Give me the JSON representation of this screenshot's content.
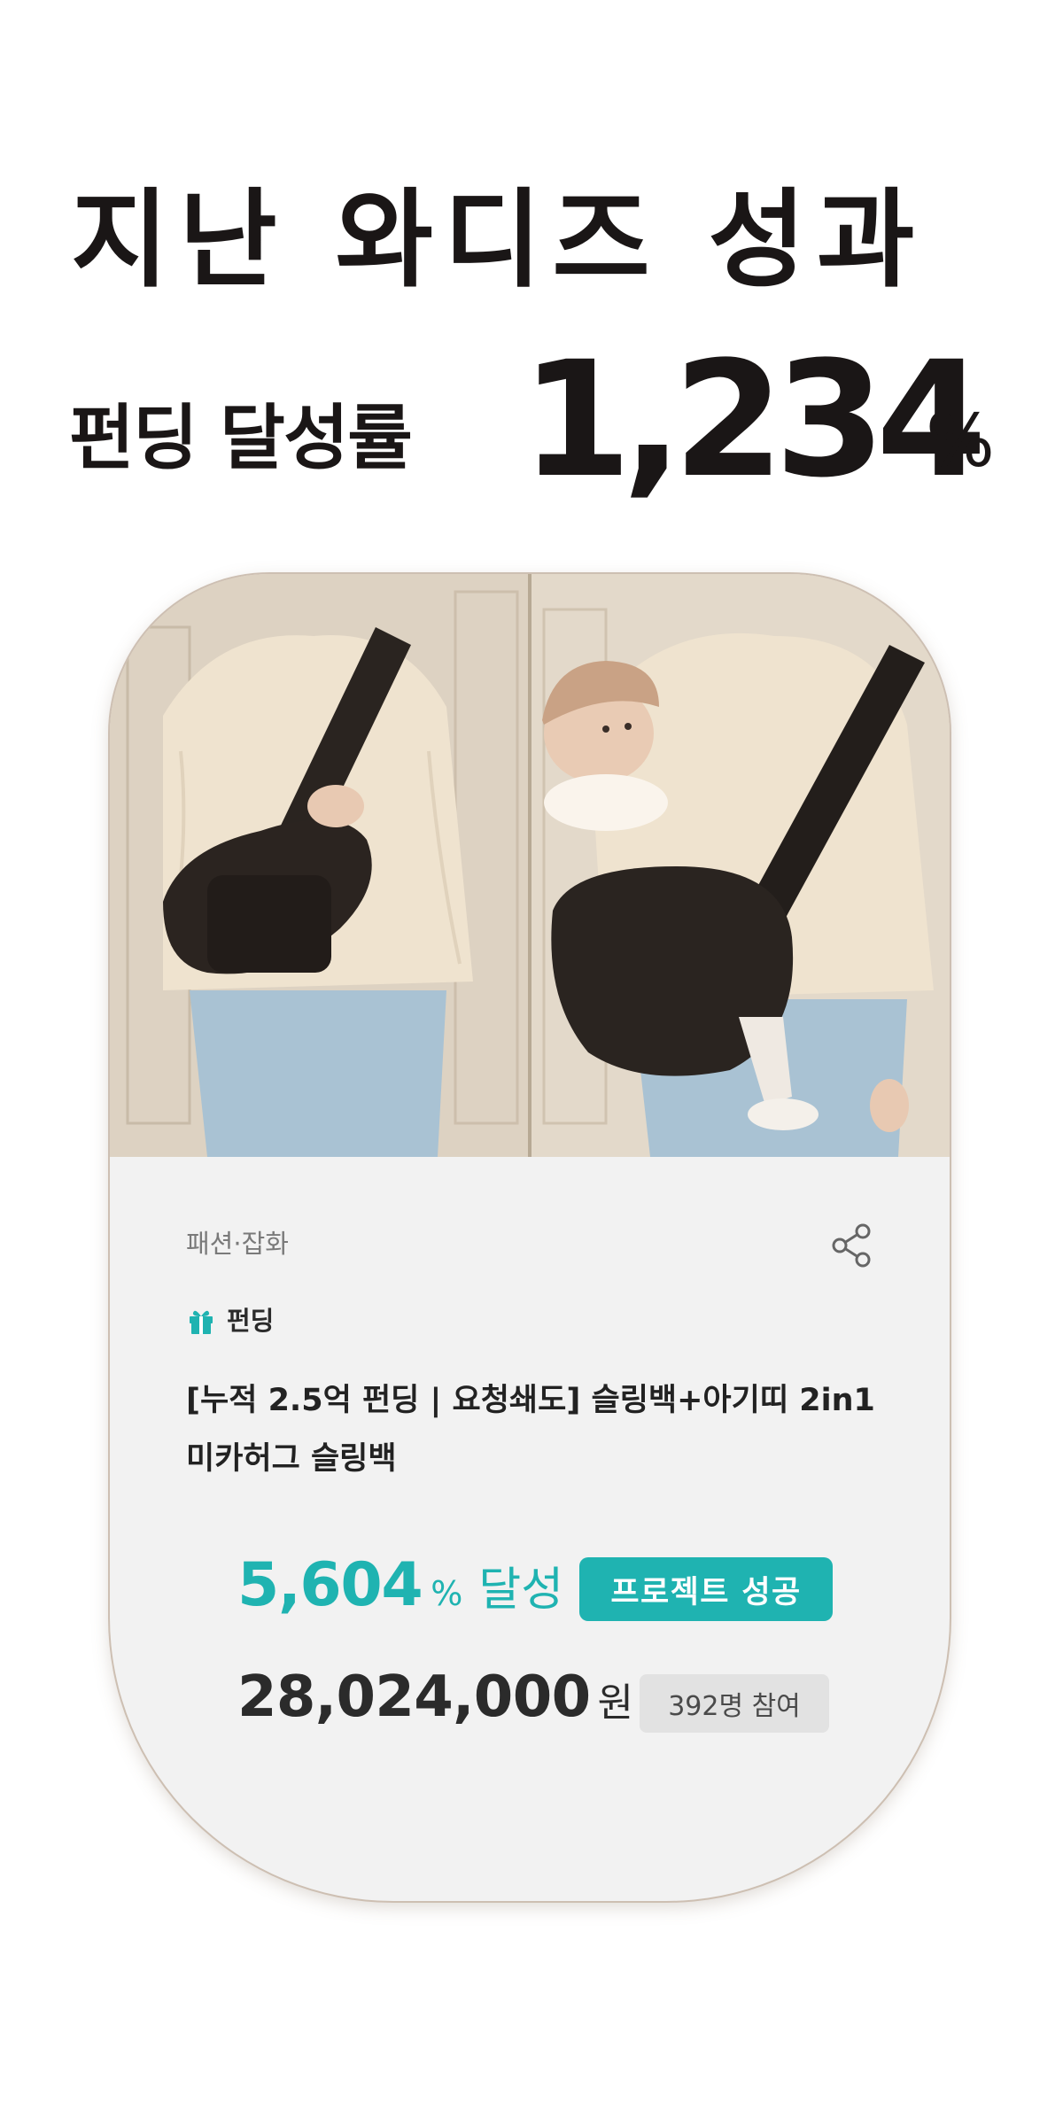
{
  "header": {
    "headline": "지난 와디즈 성과",
    "rate_label": "펀딩 달성률",
    "rate_value": "1,234",
    "rate_unit": "%"
  },
  "card": {
    "category": "패션·잡화",
    "share_icon": "share-icon",
    "type_icon": "gift-icon",
    "type_label": "펀딩",
    "title": "[누적 2.5억 펀딩 | 요청쇄도] 슬링백+아기띠 2in1 미카허그 슬링백",
    "achievement_value": "5,604",
    "achievement_unit": "%",
    "achievement_suffix": "달성",
    "status_badge": "프로젝트 성공",
    "amount_value": "28,024,000",
    "amount_unit": "원",
    "participants": "392명 참여"
  },
  "colors": {
    "accent": "#1fb3b1",
    "text_dark": "#1a1616",
    "card_bg": "#f2f2f2"
  }
}
